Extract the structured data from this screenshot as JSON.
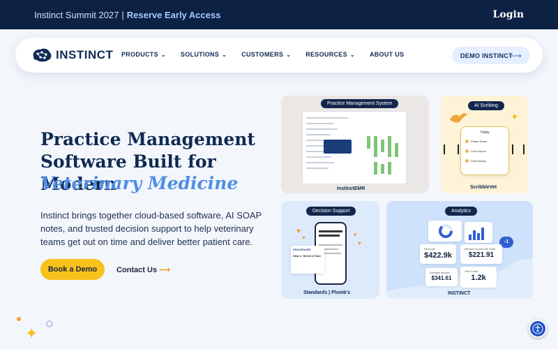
{
  "banner": {
    "event": "Instinct Summit 2027",
    "separator": "|",
    "cta": "Reserve Early Access",
    "login": "Login"
  },
  "nav": {
    "brand": "INSTINCT",
    "items": [
      {
        "label": "PRODUCTS",
        "has_dropdown": true
      },
      {
        "label": "SOLUTIONS",
        "has_dropdown": true
      },
      {
        "label": "CUSTOMERS",
        "has_dropdown": true
      },
      {
        "label": "RESOURCES",
        "has_dropdown": true
      },
      {
        "label": "ABOUT US",
        "has_dropdown": false
      }
    ],
    "demo_button": "DEMO INSTINCT"
  },
  "hero": {
    "headline_line1": "Practice Management",
    "headline_line2": "Software Built for Modern",
    "headline_accent": "Veterinary Medicine",
    "lead": "Instinct brings together cloud-based software, AI SOAP notes, and trusted decision support to help veterinary teams get out on time and deliver better patient care.",
    "primary_cta": "Book a Demo",
    "secondary_cta": "Contact Us"
  },
  "cards": {
    "practice": {
      "label": "Practice Management System",
      "brand": "InstinctEMR"
    },
    "scribing": {
      "label": "AI Scribing",
      "brand": "ScribbleVet",
      "panel_title": "Today",
      "patients": [
        "Potato Relan",
        "Luna Sprout",
        "Polly Spring"
      ]
    },
    "decision": {
      "label": "Decision Support",
      "procedure_tag": "PROCEDURE",
      "procedure_step": "Step 1: Select a Tube",
      "brands": "Standards | Plumb's"
    },
    "analytics": {
      "label": "Analytics",
      "brand": "INSTINCT",
      "badge": "-1",
      "stats": [
        {
          "label": "Revenue",
          "value": "$422.9k"
        },
        {
          "label": "Median Invoice Net Total",
          "value": "$221.91"
        },
        {
          "label": "Average Invoice",
          "value": "$341.61"
        },
        {
          "label": "Visit Count",
          "value": "1.2k"
        }
      ]
    }
  },
  "colors": {
    "banner_bg": "#0c2143",
    "accent_blue": "#4e8fe6",
    "cta_yellow": "#f7c21b",
    "navy": "#0f2a52"
  }
}
